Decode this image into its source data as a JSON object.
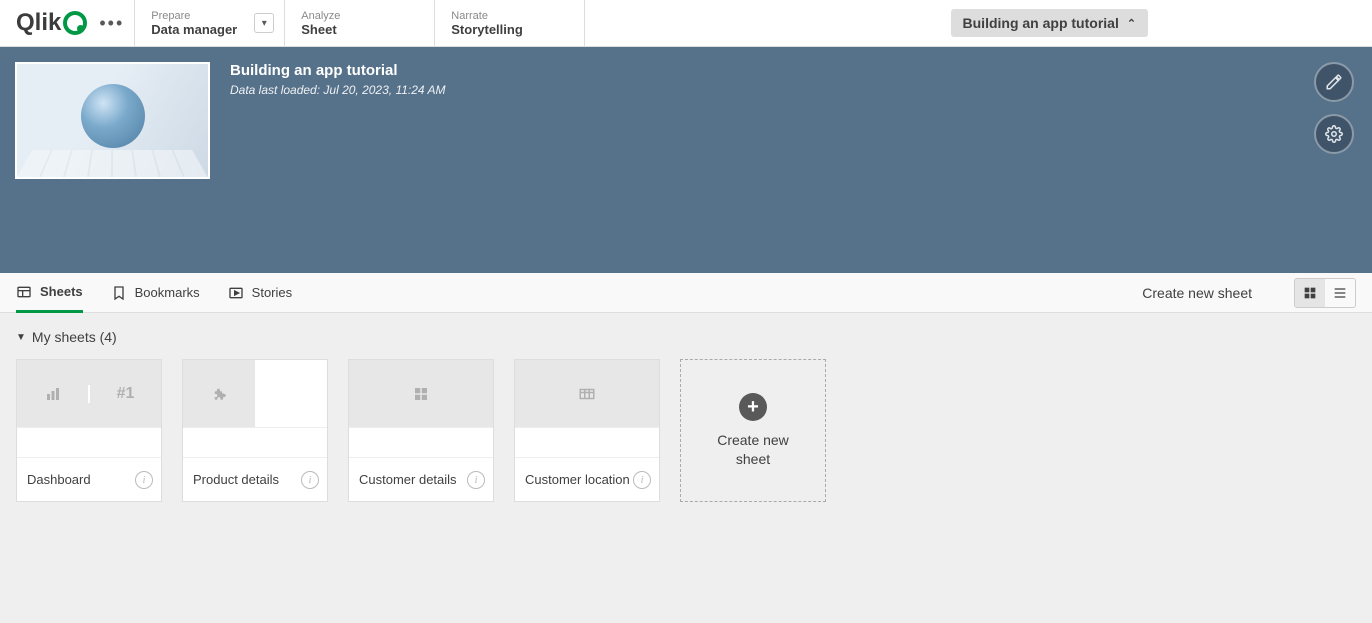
{
  "topbar": {
    "logo_text": "Qlik",
    "nav": [
      {
        "top": "Prepare",
        "bottom": "Data manager",
        "has_dropdown": true
      },
      {
        "top": "Analyze",
        "bottom": "Sheet",
        "has_dropdown": false
      },
      {
        "top": "Narrate",
        "bottom": "Storytelling",
        "has_dropdown": false
      }
    ],
    "breadcrumb": "Building an app tutorial"
  },
  "hero": {
    "title": "Building an app tutorial",
    "subtitle": "Data last loaded: Jul 20, 2023, 11:24 AM"
  },
  "tabs": {
    "items": [
      {
        "label": "Sheets",
        "icon": "sheets-icon",
        "active": true
      },
      {
        "label": "Bookmarks",
        "icon": "bookmark-icon",
        "active": false
      },
      {
        "label": "Stories",
        "icon": "play-icon",
        "active": false
      }
    ],
    "create_label": "Create new sheet"
  },
  "section": {
    "title": "My sheets (4)"
  },
  "sheets": [
    {
      "name": "Dashboard",
      "preview": "dashboard"
    },
    {
      "name": "Product details",
      "preview": "product"
    },
    {
      "name": "Customer details",
      "preview": "grid"
    },
    {
      "name": "Customer location",
      "preview": "table"
    }
  ],
  "create_card": {
    "label": "Create new sheet"
  }
}
